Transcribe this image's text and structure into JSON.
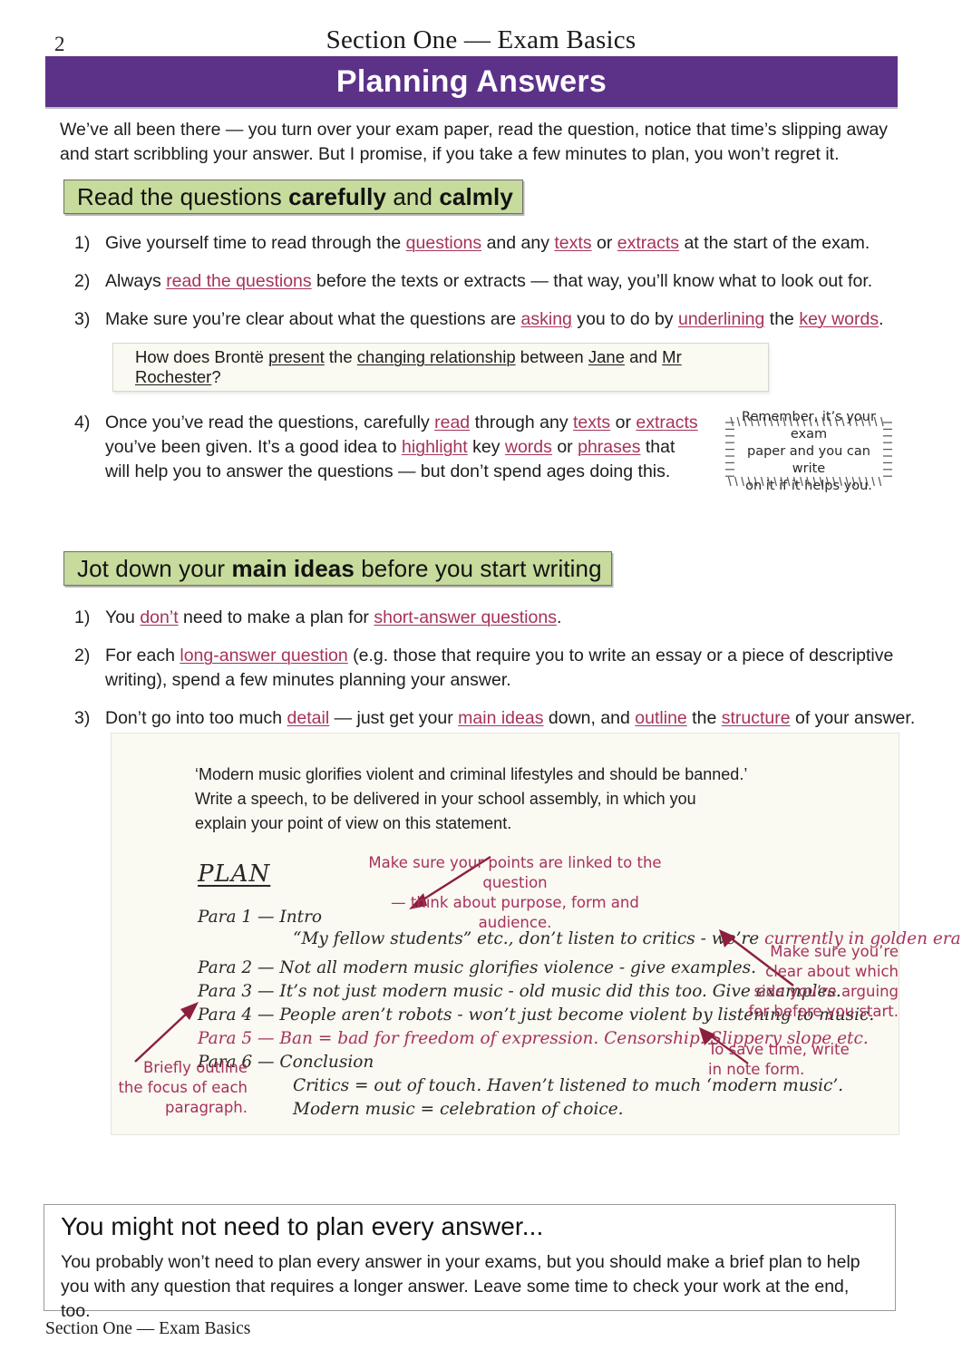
{
  "page": {
    "number": "2",
    "running_head": "Section One — Exam Basics",
    "footer": "Section One — Exam Basics",
    "banner_title": "Planning Answers",
    "colors": {
      "banner_purple": "#5C3289",
      "heading_green": "#C7DB9C",
      "keyword_crimson": "#A6325C",
      "box_cream": "#FAF9F2"
    }
  },
  "intro": "We’ve all been there — you turn over your exam paper, read the question, notice that time’s slipping away and start scribbling your answer.  But I promise, if you take a few minutes to plan, you won’t regret it.",
  "section1": {
    "heading_pre": "Read the questions ",
    "heading_bold1": "carefully",
    "heading_mid": " and ",
    "heading_bold2": "calmly",
    "items": [
      {
        "num": "1)",
        "parts": [
          {
            "t": "Give yourself time to read through the ",
            "s": "plain"
          },
          {
            "t": "questions",
            "s": "kw"
          },
          {
            "t": " and any ",
            "s": "plain"
          },
          {
            "t": "texts",
            "s": "kw"
          },
          {
            "t": " or ",
            "s": "plain"
          },
          {
            "t": "extracts",
            "s": "kw"
          },
          {
            "t": " at the start of the exam.",
            "s": "plain"
          }
        ]
      },
      {
        "num": "2)",
        "parts": [
          {
            "t": "Always ",
            "s": "plain"
          },
          {
            "t": "read the questions",
            "s": "kw"
          },
          {
            "t": " before the texts or extracts — that way, you’ll know what to look out for.",
            "s": "plain"
          }
        ]
      },
      {
        "num": "3)",
        "parts": [
          {
            "t": "Make sure you’re clear about what the questions are ",
            "s": "plain"
          },
          {
            "t": "asking",
            "s": "kw"
          },
          {
            "t": " you to do by ",
            "s": "plain"
          },
          {
            "t": "underlining",
            "s": "kw"
          },
          {
            "t": " the ",
            "s": "plain"
          },
          {
            "t": "key words",
            "s": "kw"
          },
          {
            "t": ".",
            "s": "plain"
          }
        ]
      },
      {
        "num": "4)",
        "parts": [
          {
            "t": "Once you’ve read the questions, carefully ",
            "s": "plain"
          },
          {
            "t": "read",
            "s": "kw"
          },
          {
            "t": " through any ",
            "s": "plain"
          },
          {
            "t": "texts",
            "s": "kw"
          },
          {
            "t": " or ",
            "s": "plain"
          },
          {
            "t": "extracts",
            "s": "kw"
          },
          {
            "t": " you’ve been given.  It’s a good idea to ",
            "s": "plain"
          },
          {
            "t": "highlight",
            "s": "kw"
          },
          {
            "t": " key ",
            "s": "plain"
          },
          {
            "t": "words",
            "s": "kw"
          },
          {
            "t": " or ",
            "s": "plain"
          },
          {
            "t": "phrases",
            "s": "kw"
          },
          {
            "t": " that will help you to answer the questions — but don’t spend ages doing this.",
            "s": "plain"
          }
        ]
      }
    ],
    "example_question": [
      {
        "t": "How does Brontë ",
        "s": "plain"
      },
      {
        "t": "present",
        "s": "uw"
      },
      {
        "t": " the ",
        "s": "plain"
      },
      {
        "t": "changing relationship",
        "s": "uw"
      },
      {
        "t": " between ",
        "s": "plain"
      },
      {
        "t": "Jane",
        "s": "uw"
      },
      {
        "t": " and ",
        "s": "plain"
      },
      {
        "t": "Mr Rochester",
        "s": "uw"
      },
      {
        "t": "?",
        "s": "plain"
      }
    ],
    "tick_note": [
      "Remember, it’s your exam",
      "paper and you can write",
      "on it if it helps you."
    ]
  },
  "section2": {
    "heading_pre": "Jot down your ",
    "heading_bold": "main ideas",
    "heading_post": " before you start writing",
    "items": [
      {
        "num": "1)",
        "parts": [
          {
            "t": "You ",
            "s": "plain"
          },
          {
            "t": "don’t",
            "s": "kw"
          },
          {
            "t": " need to make a plan for ",
            "s": "plain"
          },
          {
            "t": "short-answer questions",
            "s": "kw"
          },
          {
            "t": ".",
            "s": "plain"
          }
        ]
      },
      {
        "num": "2)",
        "parts": [
          {
            "t": "For each ",
            "s": "plain"
          },
          {
            "t": "long-answer question",
            "s": "kw"
          },
          {
            "t": " (e.g. those that require you to write an essay or a piece of descriptive writing), spend a few minutes planning your answer.",
            "s": "plain"
          }
        ]
      },
      {
        "num": "3)",
        "parts": [
          {
            "t": "Don’t go into too much ",
            "s": "plain"
          },
          {
            "t": "detail",
            "s": "kw"
          },
          {
            "t": " — just get your ",
            "s": "plain"
          },
          {
            "t": "main ideas",
            "s": "kw"
          },
          {
            "t": " down, and ",
            "s": "plain"
          },
          {
            "t": "outline",
            "s": "kw"
          },
          {
            "t": " the ",
            "s": "plain"
          },
          {
            "t": "structure",
            "s": "kw"
          },
          {
            "t": " of your answer.",
            "s": "plain"
          }
        ]
      }
    ]
  },
  "plan_example": {
    "statement_line1": "‘Modern music glorifies violent and criminal lifestyles and should be banned.’",
    "statement_line2": "Write a speech, to be delivered in your school assembly, in which you",
    "statement_line3": "explain your point of view on this statement.",
    "plan_label": "PLAN",
    "lines": [
      {
        "text": "Para 1 — Intro",
        "color": "dark",
        "indent": 0
      },
      {
        "text": "“My fellow students” etc., don’t listen to critics - we’re ",
        "tail": "currently in golden era of music.",
        "color": "split",
        "indent": 1
      },
      {
        "text": "Para 2 — Not all modern music glorifies violence - give examples.",
        "color": "dark",
        "indent": 0
      },
      {
        "text": "Para 3 — It’s not just modern music - old music did this too.  Give examples.",
        "color": "dark",
        "indent": 0
      },
      {
        "text": "Para 4 — People aren’t robots - won’t just become violent by listening to music.",
        "color": "dark",
        "indent": 0
      },
      {
        "text": "Para 5 — Ban = bad for freedom of expression.  Censorship.  Slippery slope etc.",
        "color": "red",
        "indent": 0
      },
      {
        "text": "Para 6 — Conclusion",
        "color": "dark",
        "indent": 0
      },
      {
        "text": "Critics = out of touch.  Haven’t listened to much ‘modern music’.",
        "color": "dark",
        "indent": 1
      },
      {
        "text": "Modern music = celebration of choice.",
        "color": "dark",
        "indent": 1
      }
    ],
    "annotations": {
      "top": [
        "Make sure your points are linked to the question",
        "— think about purpose, form and audience."
      ],
      "right_upper": [
        "Make sure you’re",
        "clear about which",
        "side you’re arguing",
        "for before you start."
      ],
      "right_lower": [
        "To save time, write",
        "in note form."
      ],
      "bottom_left": [
        "Briefly outline",
        "the focus of each",
        "paragraph."
      ]
    }
  },
  "summary": {
    "title": "You might not need to plan every answer...",
    "text": "You probably won’t need to plan every answer in your exams, but you should make a brief plan to help you with any question that requires a longer answer.  Leave some time to check your work at the end, too."
  }
}
